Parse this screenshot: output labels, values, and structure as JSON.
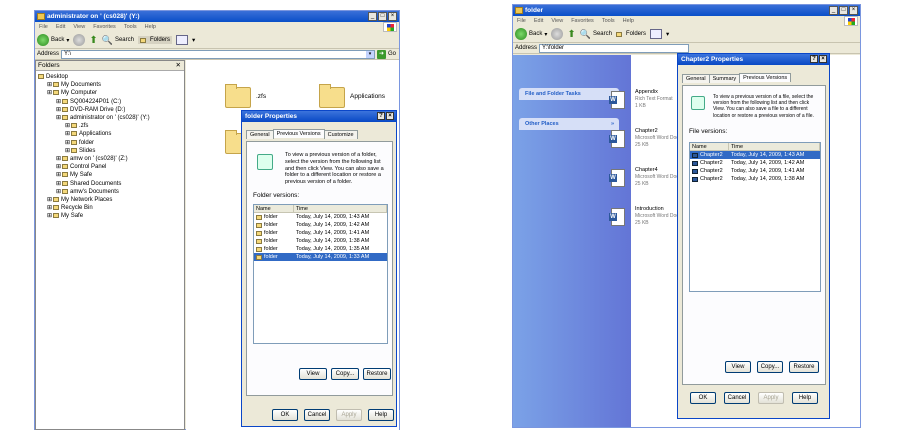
{
  "left": {
    "title": "administrator on ' (cs028)' (Y:)",
    "menu": [
      "File",
      "Edit",
      "View",
      "Favorites",
      "Tools",
      "Help"
    ],
    "toolbar": {
      "back": "Back",
      "search": "Search",
      "folders": "Folders"
    },
    "address_label": "Address",
    "address_value": "Y:\\",
    "go": "Go",
    "folders_header": "Folders",
    "tree": [
      {
        "label": "Desktop",
        "level": 0
      },
      {
        "label": "My Documents",
        "level": 1
      },
      {
        "label": "My Computer",
        "level": 1
      },
      {
        "label": "SQ004224P01 (C:)",
        "level": 2
      },
      {
        "label": "DVD-RAM Drive (D:)",
        "level": 2
      },
      {
        "label": "administrator on ' (cs028)' (Y:)",
        "level": 2
      },
      {
        "label": ".zfs",
        "level": 3
      },
      {
        "label": "Applications",
        "level": 3
      },
      {
        "label": "folder",
        "level": 3
      },
      {
        "label": "Slides",
        "level": 3
      },
      {
        "label": "amw on ' (cs028)' (Z:)",
        "level": 2
      },
      {
        "label": "Control Panel",
        "level": 2
      },
      {
        "label": "My Safe",
        "level": 2
      },
      {
        "label": "Shared Documents",
        "level": 2
      },
      {
        "label": "amw's Documents",
        "level": 2
      },
      {
        "label": "My Network Places",
        "level": 1
      },
      {
        "label": "Recycle Bin",
        "level": 1
      },
      {
        "label": "My Safe",
        "level": 1
      }
    ],
    "folders": [
      ".zfs",
      "Applications",
      "folder"
    ],
    "dialog": {
      "title": "folder Properties",
      "tabs": [
        "General",
        "Previous Versions",
        "Customize"
      ],
      "info": "To view a previous version of a folder, select the version from the following list and then click View. You can also save a folder to a different location or restore a previous version of a folder.",
      "list_label": "Folder versions:",
      "columns": [
        "Name",
        "Time"
      ],
      "rows": [
        {
          "name": "folder",
          "time": "Today, July 14, 2009, 1:43 AM"
        },
        {
          "name": "folder",
          "time": "Today, July 14, 2009, 1:42 AM"
        },
        {
          "name": "folder",
          "time": "Today, July 14, 2009, 1:41 AM"
        },
        {
          "name": "folder",
          "time": "Today, July 14, 2009, 1:38 AM"
        },
        {
          "name": "folder",
          "time": "Today, July 14, 2009, 1:35 AM"
        },
        {
          "name": "folder",
          "time": "Today, July 14, 2009, 1:33 AM"
        }
      ],
      "buttons": [
        "View",
        "Copy...",
        "Restore"
      ],
      "footer": [
        "OK",
        "Cancel",
        "Apply",
        "Help"
      ]
    }
  },
  "right": {
    "title": "folder",
    "menu": [
      "File",
      "Edit",
      "View",
      "Favorites",
      "Tools",
      "Help"
    ],
    "toolbar": {
      "back": "Back",
      "search": "Search",
      "folders": "Folders"
    },
    "address_label": "Address",
    "address_value": "Y:\\folder",
    "go": "Go",
    "side": [
      "File and Folder Tasks",
      "Other Places"
    ],
    "files": [
      {
        "name": "Appendix",
        "type": "Rich Text Format",
        "size": "1 KB"
      },
      {
        "name": "Chapter2",
        "type": "Microsoft Word Docu...",
        "size": "25 KB"
      },
      {
        "name": "Chapter4",
        "type": "Microsoft Word Docu...",
        "size": "25 KB"
      },
      {
        "name": "Introduction",
        "type": "Microsoft Word Docu...",
        "size": "25 KB"
      }
    ],
    "dialog": {
      "title": "Chapter2 Properties",
      "tabs": [
        "General",
        "Summary",
        "Previous Versions"
      ],
      "info": "To view a previous version of a file, select the version from the following list and then click View. You can also save a file to a different location or restore a previous version of a file.",
      "list_label": "File versions:",
      "columns": [
        "Name",
        "Time"
      ],
      "rows": [
        {
          "name": "Chapter2",
          "time": "Today, July 14, 2009, 1:43 AM"
        },
        {
          "name": "Chapter2",
          "time": "Today, July 14, 2009, 1:42 AM"
        },
        {
          "name": "Chapter2",
          "time": "Today, July 14, 2009, 1:41 AM"
        },
        {
          "name": "Chapter2",
          "time": "Today, July 14, 2009, 1:38 AM"
        }
      ],
      "buttons": [
        "View",
        "Copy...",
        "Restore"
      ],
      "footer": [
        "OK",
        "Cancel",
        "Apply",
        "Help"
      ]
    }
  }
}
